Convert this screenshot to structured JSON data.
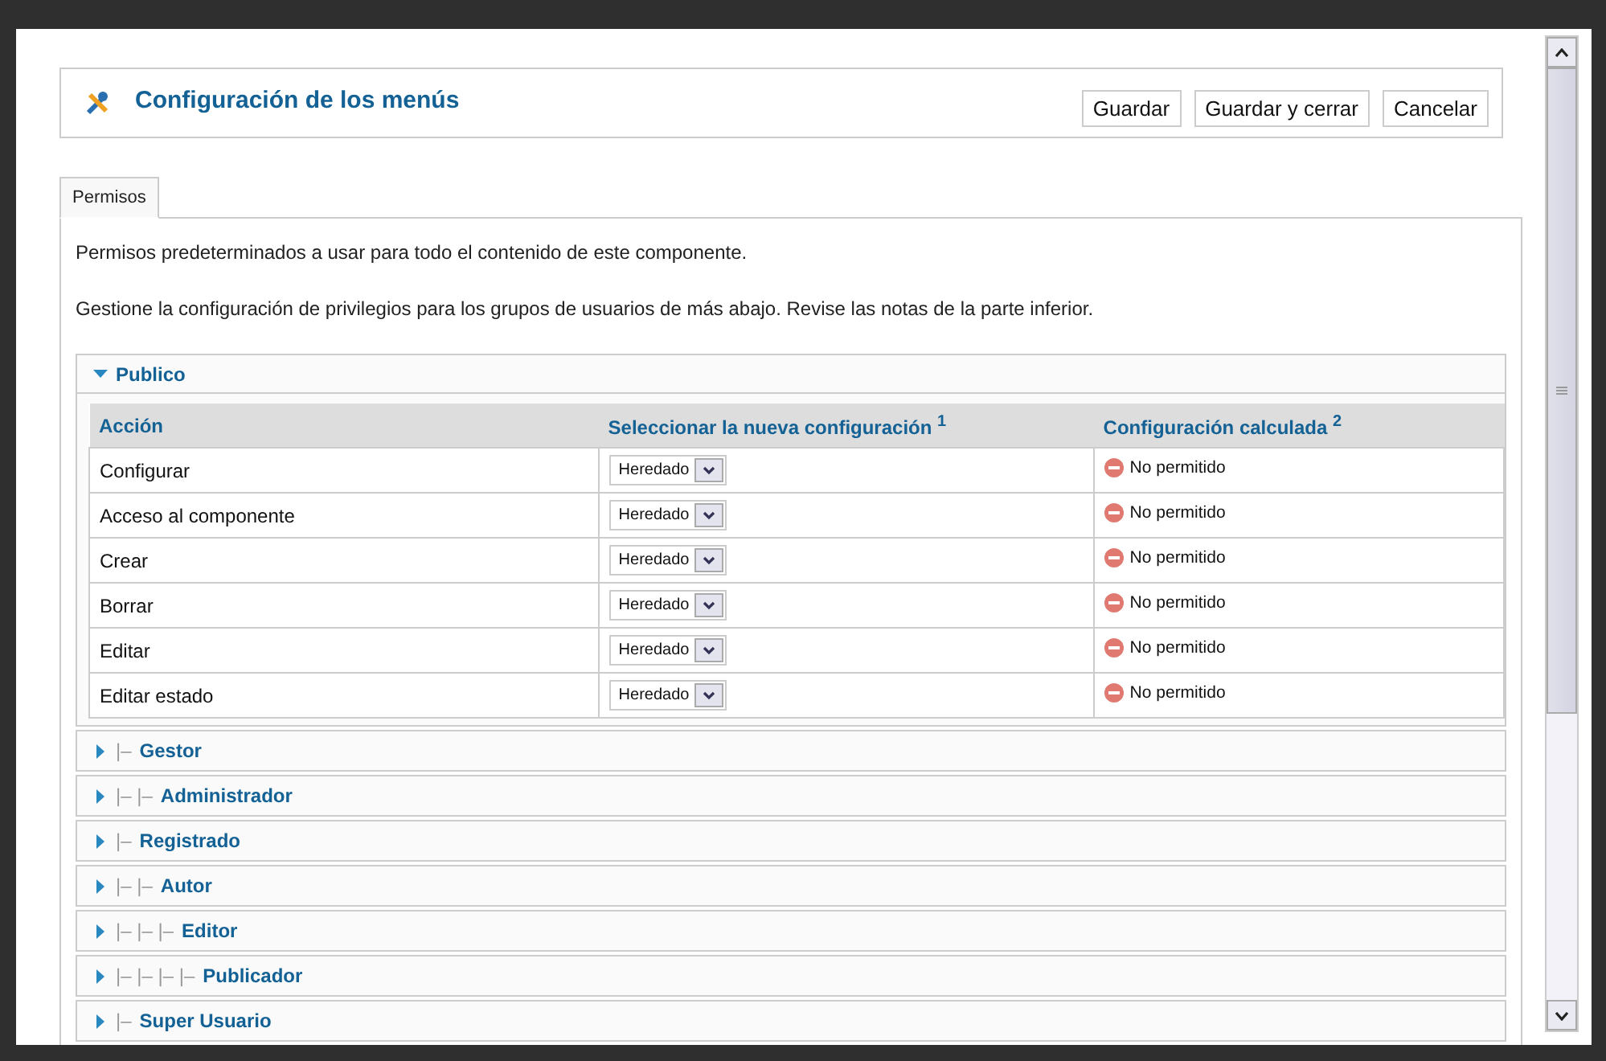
{
  "header": {
    "title": "Configuración de los menús",
    "buttons": [
      "Guardar",
      "Guardar y cerrar",
      "Cancelar"
    ]
  },
  "tabs": [
    {
      "label": "Permisos",
      "selected": true
    }
  ],
  "intro": [
    "Permisos predeterminados a usar para todo el contenido de este componente.",
    "Gestione la configuración de privilegios para los grupos de usuarios de más abajo. Revise las notas de la parte inferior."
  ],
  "groups": [
    {
      "name": "Publico",
      "expanded": true,
      "table": {
        "columns": [
          "Acción",
          "Seleccionar la nueva configuración $^{1}$",
          "Configuración calculada $^{2}$"
        ],
        "rows": [
          {
            "action": "Configurar",
            "setting": "Heredado",
            "calculated": "No permitido",
            "allowed": false
          },
          {
            "action": "Acceso al componente",
            "setting": "Heredado",
            "calculated": "No permitido",
            "allowed": false
          },
          {
            "action": "Crear",
            "setting": "Heredado",
            "calculated": "No permitido",
            "allowed": false
          },
          {
            "action": "Borrar",
            "setting": "Heredado",
            "calculated": "No permitido",
            "allowed": false
          },
          {
            "action": "Editar",
            "setting": "Heredado",
            "calculated": "No permitido",
            "allowed": false
          },
          {
            "action": "Editar estado",
            "setting": "Heredado",
            "calculated": "No permitido",
            "allowed": false
          }
        ]
      }
    },
    {
      "prefix": "|–",
      "name": "Gestor",
      "expanded": false
    },
    {
      "prefix": "|– |–",
      "name": "Administrador",
      "expanded": false
    },
    {
      "prefix": "|–",
      "name": "Registrado",
      "expanded": false
    },
    {
      "prefix": "|– |–",
      "name": "Autor",
      "expanded": false
    },
    {
      "prefix": "|– |– |–",
      "name": "Editor",
      "expanded": false
    },
    {
      "prefix": "|– |– |– |–",
      "name": "Publicador",
      "expanded": false
    },
    {
      "prefix": "|–",
      "name": "Super Usuario",
      "expanded": false
    }
  ]
}
